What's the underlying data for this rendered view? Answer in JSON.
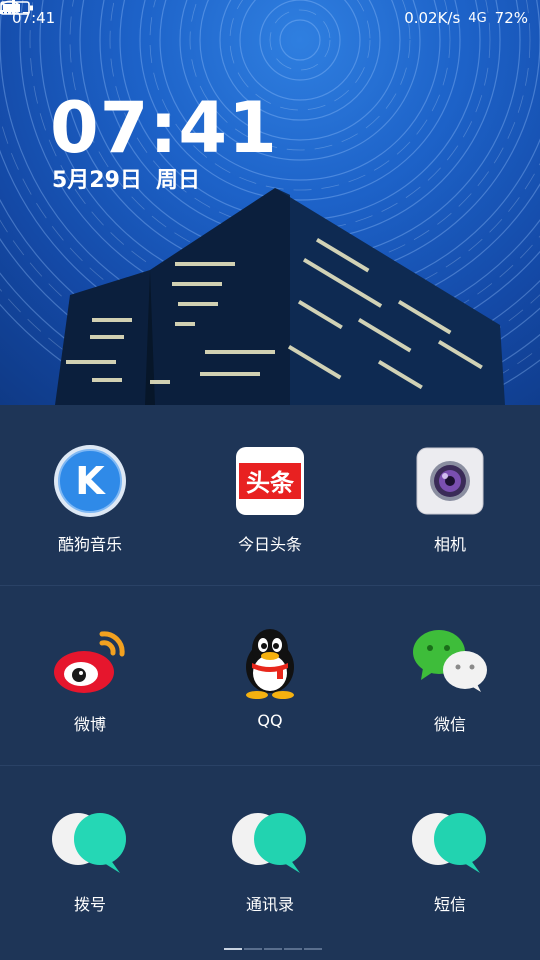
{
  "status_bar": {
    "time": "07:41",
    "network_speed": "0.02K/s",
    "network_type": "4G",
    "battery": "72%"
  },
  "lock_clock": {
    "time": "07:41",
    "date": "5月29日",
    "weekday": "周日"
  },
  "apps": [
    {
      "label": "酷狗音乐",
      "icon": "kugou-music-icon"
    },
    {
      "label": "今日头条",
      "icon": "toutiao-icon"
    },
    {
      "label": "相机",
      "icon": "camera-icon"
    },
    {
      "label": "微博",
      "icon": "weibo-icon"
    },
    {
      "label": "QQ",
      "icon": "qq-icon"
    },
    {
      "label": "微信",
      "icon": "wechat-icon"
    },
    {
      "label": "拨号",
      "icon": "dialer-icon"
    },
    {
      "label": "通讯录",
      "icon": "contacts-icon"
    },
    {
      "label": "短信",
      "icon": "messages-icon"
    }
  ],
  "icon_text": {
    "kugou": "K",
    "toutiao": "头条"
  },
  "colors": {
    "drawer_bg": "#1e3557",
    "teal_accent": "#22d3b0",
    "toutiao_red": "#e82121",
    "kugou_blue": "#2f8ae8"
  }
}
